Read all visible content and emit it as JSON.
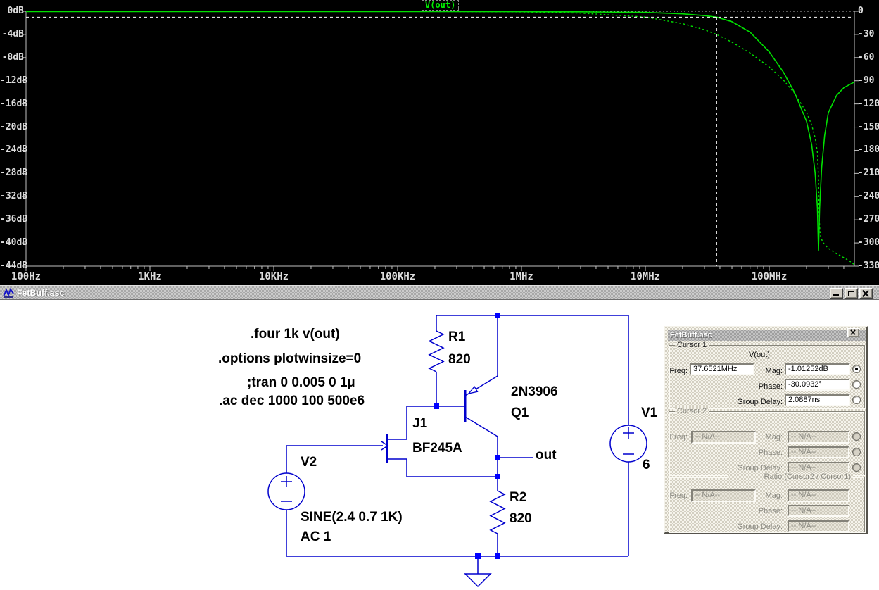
{
  "window": {
    "title": "FetBuff.asc",
    "controls": {
      "minimize": "minimize",
      "maximize": "maximize",
      "close": "close"
    }
  },
  "plot": {
    "trace_label": "V(out)",
    "colors": {
      "background": "#000000",
      "trace": "#00e000",
      "axis": "#c0c0c0",
      "tick_text": "#dcdcdc",
      "cursor": "#ffffff",
      "zero_gridline": "#b0b0b0"
    }
  },
  "chart_data": {
    "type": "line",
    "title": "V(out)",
    "x_axis": {
      "scale": "log",
      "unit": "Hz",
      "min": 100,
      "max": 500000000,
      "tick_labels": [
        "100Hz",
        "1KHz",
        "10KHz",
        "100KHz",
        "1MHz",
        "10MHz",
        "100MHz"
      ]
    },
    "y_axis_left": {
      "unit": "dB",
      "max": 0,
      "min": -44,
      "step": -4,
      "tick_labels": [
        "0dB",
        "-4dB",
        "-8dB",
        "-12dB",
        "-16dB",
        "-20dB",
        "-24dB",
        "-28dB",
        "-32dB",
        "-36dB",
        "-40dB",
        "-44dB"
      ]
    },
    "y_axis_right": {
      "unit": "deg",
      "max": 0,
      "min": -330,
      "step": -30,
      "tick_labels": [
        "0",
        "-30",
        "-60",
        "-90",
        "-120",
        "-150",
        "-180",
        "-210",
        "-240",
        "-270",
        "-300",
        "-330"
      ]
    },
    "grid": "ticks-only",
    "legend_position": "top-center-boxed",
    "series": [
      {
        "name": "V(out) magnitude",
        "axis": "left",
        "line_style": "solid",
        "color": "#00e000",
        "points_hz_db": [
          [
            100,
            -0.05
          ],
          [
            1000,
            -0.05
          ],
          [
            10000,
            -0.05
          ],
          [
            100000,
            -0.05
          ],
          [
            1000000,
            -0.07
          ],
          [
            3000000,
            -0.1
          ],
          [
            10000000,
            -0.2
          ],
          [
            20000000,
            -0.45
          ],
          [
            30000000,
            -0.75
          ],
          [
            37652100,
            -1.01
          ],
          [
            50000000,
            -1.8
          ],
          [
            70000000,
            -3.6
          ],
          [
            100000000,
            -7
          ],
          [
            130000000,
            -10.5
          ],
          [
            160000000,
            -14
          ],
          [
            200000000,
            -19
          ],
          [
            220000000,
            -23
          ],
          [
            235000000,
            -28
          ],
          [
            245000000,
            -34
          ],
          [
            250000000,
            -41.3
          ],
          [
            255000000,
            -34
          ],
          [
            265000000,
            -27
          ],
          [
            280000000,
            -21.5
          ],
          [
            300000000,
            -17.5
          ],
          [
            350000000,
            -14.5
          ],
          [
            400000000,
            -13.2
          ],
          [
            450000000,
            -12.6
          ],
          [
            500000000,
            -12.2
          ]
        ]
      },
      {
        "name": "V(out) phase",
        "axis": "right",
        "line_style": "dotted",
        "color": "#00e000",
        "points_hz_deg": [
          [
            100,
            0
          ],
          [
            10000,
            0
          ],
          [
            100000,
            -0.1
          ],
          [
            1000000,
            -0.8
          ],
          [
            3000000,
            -2.5
          ],
          [
            10000000,
            -7.5
          ],
          [
            20000000,
            -16
          ],
          [
            30000000,
            -24
          ],
          [
            37652100,
            -30.09
          ],
          [
            50000000,
            -40
          ],
          [
            70000000,
            -54
          ],
          [
            100000000,
            -72
          ],
          [
            130000000,
            -89
          ],
          [
            160000000,
            -106
          ],
          [
            200000000,
            -131
          ],
          [
            220000000,
            -147
          ],
          [
            235000000,
            -164
          ],
          [
            245000000,
            -183
          ],
          [
            250000000,
            -215
          ],
          [
            253000000,
            -262
          ],
          [
            256000000,
            -283
          ],
          [
            260000000,
            -291
          ],
          [
            270000000,
            -299
          ],
          [
            300000000,
            -307
          ],
          [
            350000000,
            -314
          ],
          [
            400000000,
            -319
          ],
          [
            450000000,
            -324
          ],
          [
            500000000,
            -328
          ]
        ]
      }
    ],
    "cursor": {
      "freq_hz": 37652100,
      "mag_db": -1.01252,
      "phase_deg": -30.0932,
      "style": "white-dashed-crosshair"
    }
  },
  "schematic": {
    "directives": {
      "four": ".four 1k v(out)",
      "options": ".options plotwinsize=0",
      "tran": ";tran 0 0.005 0 1µ",
      "ac": ".ac dec 1000 100 500e6"
    },
    "components": {
      "r1": {
        "name": "R1",
        "value": "820"
      },
      "r2": {
        "name": "R2",
        "value": "820"
      },
      "q1": {
        "name": "Q1",
        "value": "2N3906"
      },
      "j1": {
        "name": "J1",
        "value": "BF245A"
      },
      "v1": {
        "name": "V1",
        "value": "6"
      },
      "v2": {
        "name": "V2",
        "value": "SINE(2.4 0.7 1K)",
        "value2": "AC 1"
      }
    },
    "nets": {
      "out": "out"
    },
    "colors": {
      "wire": "#0000cd",
      "junction": "#0000ff",
      "text": "#000000",
      "background": "#ffffff"
    }
  },
  "cursor_panel": {
    "title": "FetBuff.asc",
    "cursor1": {
      "label": "Cursor 1",
      "trace": "V(out)",
      "freq_label": "Freq:",
      "freq_value": "37.6521MHz",
      "mag_label": "Mag:",
      "mag_value": "-1.01252dB",
      "phase_label": "Phase:",
      "phase_value": "-30.0932°",
      "group_delay_label": "Group Delay:",
      "group_delay_value": "2.0887ns",
      "selected_readout": "mag"
    },
    "cursor2": {
      "label": "Cursor 2",
      "freq_label": "Freq:",
      "freq_value": "-- N/A--",
      "mag_label": "Mag:",
      "mag_value": "-- N/A--",
      "phase_label": "Phase:",
      "phase_value": "-- N/A--",
      "group_delay_label": "Group Delay:",
      "group_delay_value": "-- N/A--"
    },
    "ratio": {
      "label": "Ratio (Cursor2 / Cursor1)",
      "freq_label": "Freq:",
      "freq_value": "-- N/A--",
      "mag_label": "Mag:",
      "mag_value": "-- N/A--",
      "phase_label": "Phase:",
      "phase_value": "-- N/A--",
      "group_delay_label": "Group Delay:",
      "group_delay_value": "-- N/A--"
    }
  }
}
